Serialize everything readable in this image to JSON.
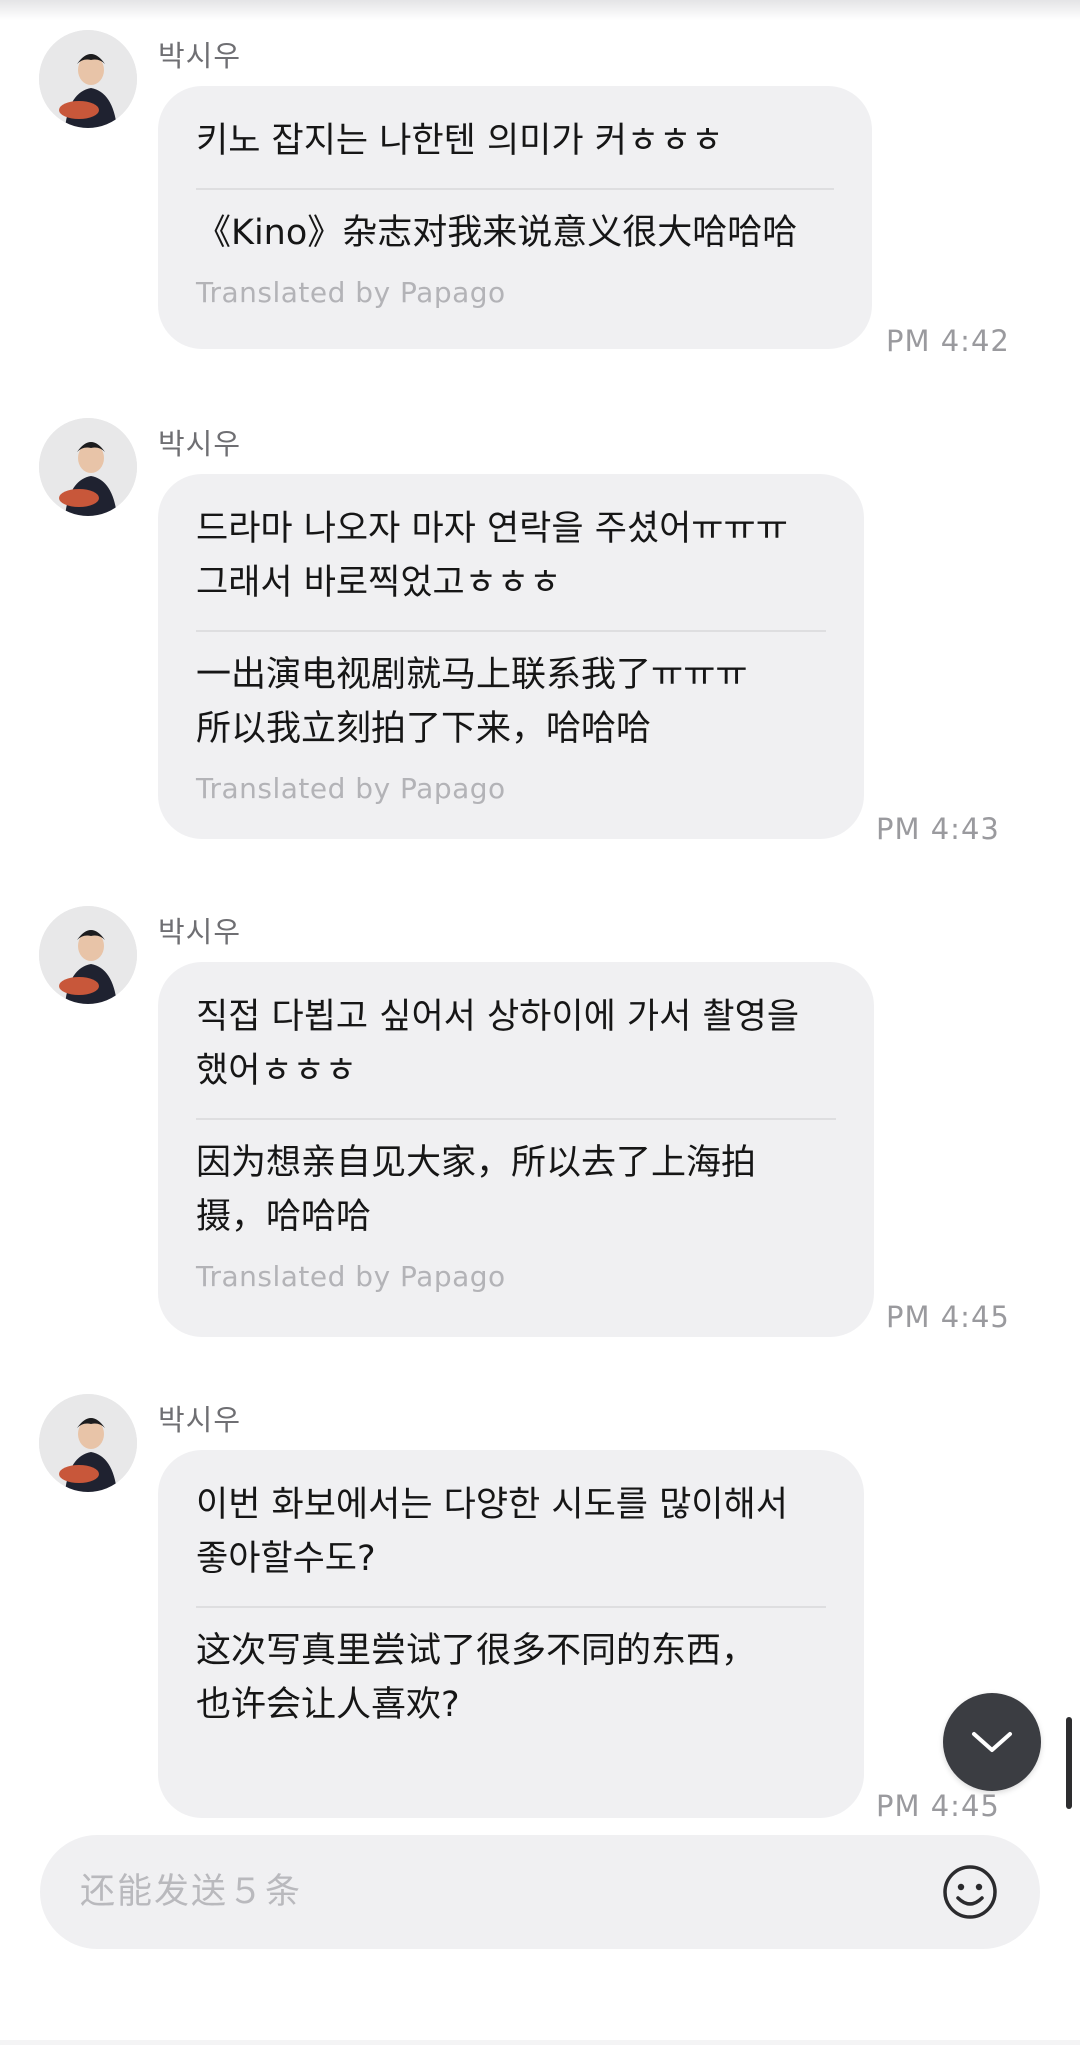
{
  "messages": [
    {
      "sender": "박시우",
      "original": "키노 잡지는 나한텐 의미가 커ㅎㅎㅎ",
      "translation": "《Kino》杂志对我来说意义很大哈哈哈",
      "credit": "Translated by Papago",
      "time": "PM 4:42"
    },
    {
      "sender": "박시우",
      "original": "드라마 나오자 마자 연락을 주셨어ㅠㅠㅠ\n그래서 바로찍었고ㅎㅎㅎ",
      "translation": "一出演电视剧就马上联系我了ㅠㅠㅠ\n所以我立刻拍了下来，哈哈哈",
      "credit": "Translated by Papago",
      "time": "PM 4:43"
    },
    {
      "sender": "박시우",
      "original": "직접 다뵙고 싶어서 상하이에 가서 촬영을\n했어ㅎㅎㅎ",
      "translation": "因为想亲自见大家，所以去了上海拍\n摄，哈哈哈",
      "credit": "Translated by Papago",
      "time": "PM 4:45"
    },
    {
      "sender": "박시우",
      "original": "이번 화보에서는 다양한 시도를 많이해서\n좋아할수도?",
      "translation": "这次写真里尝试了很多不同的东西，\n也许会让人喜欢?",
      "time": "PM 4:45"
    }
  ],
  "input": {
    "placeholder": "还能发送５条"
  },
  "icons": {
    "scroll_down": "chevron-down-icon",
    "emoji": "smiley-icon"
  },
  "colors": {
    "bubble": "#f0f0f2",
    "scroll_button": "#3b3d42",
    "text": "#161616",
    "meta": "#9a9a9e"
  }
}
